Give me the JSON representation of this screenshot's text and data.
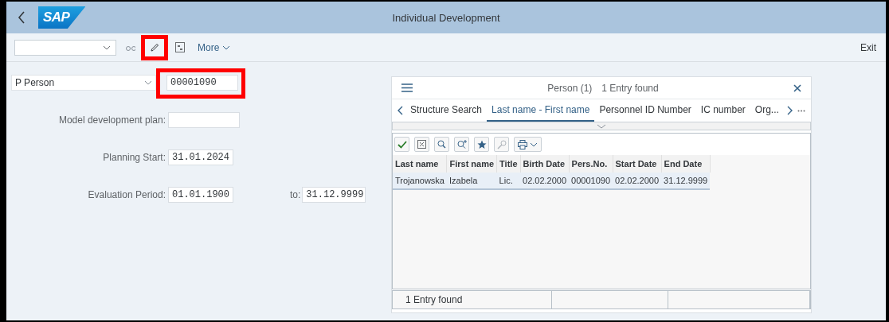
{
  "header": {
    "logo": "SAP",
    "title": "Individual Development"
  },
  "toolbar": {
    "more": "More",
    "exit": "Exit",
    "edit_highlighted": true
  },
  "object_selector": {
    "type": "P Person",
    "id": "00001090",
    "id_highlighted": true
  },
  "form": [
    {
      "label": "Model development plan:"
    },
    {
      "label": "Planning Start:",
      "value": "31.01.2024"
    },
    {
      "label": "Evaluation Period:",
      "value": "01.01.1900",
      "to_label": "to:",
      "to_value": "31.12.9999"
    }
  ],
  "popup": {
    "title": "Person (1)",
    "subtitle": "1 Entry found",
    "tabs": [
      {
        "label": "Structure Search",
        "selected": false
      },
      {
        "label": "Last name - First name",
        "selected": true
      },
      {
        "label": "Personnel ID Number",
        "selected": false
      },
      {
        "label": "IC number",
        "selected": false
      },
      {
        "label": "Org...",
        "selected": false
      }
    ],
    "table": {
      "columns": [
        "Last name",
        "First name",
        "Title",
        "Birth Date",
        "Pers.No.",
        "Start Date",
        "End Date"
      ],
      "rows": [
        {
          "cells": [
            "Trojanowska",
            "Izabela",
            "Lic.",
            "02.02.2000",
            "00001090",
            "02.02.2000",
            "31.12.9999"
          ],
          "selected": true
        }
      ]
    },
    "status": "1 Entry found"
  }
}
